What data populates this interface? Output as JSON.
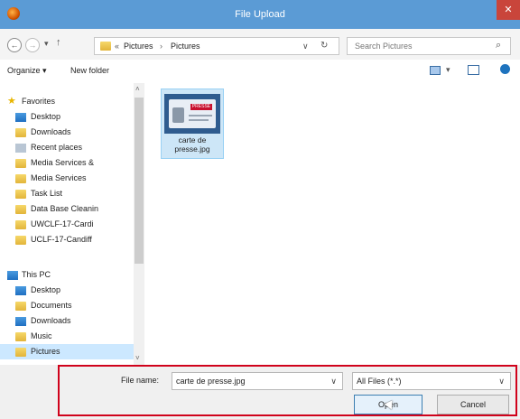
{
  "window": {
    "title": "File Upload",
    "close_glyph": "✕"
  },
  "address_bar": {
    "back_glyph": "←",
    "forward_glyph": "→",
    "recent_glyph": "▾",
    "up_glyph": "↑",
    "crumbs": [
      "«",
      "Pictures",
      "›",
      "Pictures"
    ],
    "dropdown_glyph": "∨",
    "refresh_glyph": "↻",
    "search_placeholder": "Search Pictures",
    "search_icon_glyph": "⌕"
  },
  "toolbar": {
    "organize_label": "Organize ▾",
    "new_folder_label": "New folder"
  },
  "nav": {
    "favorites": {
      "header": "Favorites",
      "items": [
        "Desktop",
        "Downloads",
        "Recent places",
        "Media Services &",
        "Media Services",
        "Task List",
        "Data Base Cleanin",
        "UWCLF-17-Cardi",
        "UCLF-17-Candiff"
      ]
    },
    "this_pc": {
      "header": "This PC",
      "items": [
        "Desktop",
        "Documents",
        "Downloads",
        "Music",
        "Pictures"
      ]
    }
  },
  "files": [
    {
      "name_line1": "carte de",
      "name_line2": "presse.jpg"
    }
  ],
  "thumbnail_badge": "PRESSE",
  "footer": {
    "filename_label": "File name:",
    "filename_value": "carte de presse.jpg",
    "filter_value": "All Files (*.*)",
    "open_label": "Open",
    "cancel_label": "Cancel"
  },
  "colors": {
    "titlebar": "#5b9bd5",
    "selection": "#cde6f7",
    "highlight_box": "#d0021b"
  }
}
